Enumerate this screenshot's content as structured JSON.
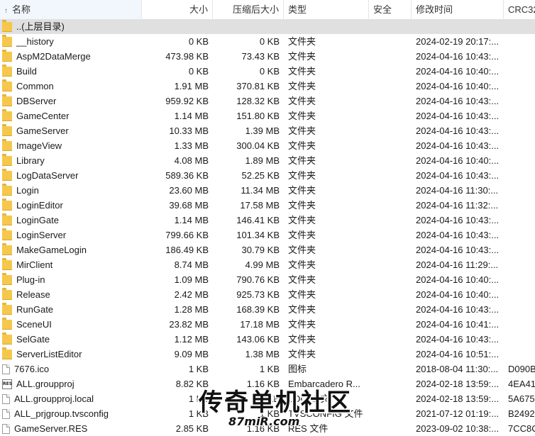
{
  "columns": {
    "name": "名称",
    "size": "大小",
    "compressed": "压缩后大小",
    "type": "类型",
    "security": "安全",
    "modified": "修改时间",
    "crc": "CRC32"
  },
  "rows": [
    {
      "icon": "folder-icon",
      "name": "..(上层目录)",
      "size": "",
      "csize": "",
      "type": "",
      "date": "",
      "crc": ""
    },
    {
      "icon": "folder-icon",
      "name": "__history",
      "size": "0 KB",
      "csize": "0 KB",
      "type": "文件夹",
      "date": "2024-02-19 20:17:...",
      "crc": ""
    },
    {
      "icon": "folder-icon",
      "name": "AspM2DataMerge",
      "size": "473.98 KB",
      "csize": "73.43 KB",
      "type": "文件夹",
      "date": "2024-04-16 10:43:...",
      "crc": ""
    },
    {
      "icon": "folder-icon",
      "name": "Build",
      "size": "0 KB",
      "csize": "0 KB",
      "type": "文件夹",
      "date": "2024-04-16 10:40:...",
      "crc": ""
    },
    {
      "icon": "folder-icon",
      "name": "Common",
      "size": "1.91 MB",
      "csize": "370.81 KB",
      "type": "文件夹",
      "date": "2024-04-16 10:40:...",
      "crc": ""
    },
    {
      "icon": "folder-icon",
      "name": "DBServer",
      "size": "959.92 KB",
      "csize": "128.32 KB",
      "type": "文件夹",
      "date": "2024-04-16 10:43:...",
      "crc": ""
    },
    {
      "icon": "folder-icon",
      "name": "GameCenter",
      "size": "1.14 MB",
      "csize": "151.80 KB",
      "type": "文件夹",
      "date": "2024-04-16 10:43:...",
      "crc": ""
    },
    {
      "icon": "folder-icon",
      "name": "GameServer",
      "size": "10.33 MB",
      "csize": "1.39 MB",
      "type": "文件夹",
      "date": "2024-04-16 10:43:...",
      "crc": ""
    },
    {
      "icon": "folder-icon",
      "name": "ImageView",
      "size": "1.33 MB",
      "csize": "300.04 KB",
      "type": "文件夹",
      "date": "2024-04-16 10:43:...",
      "crc": ""
    },
    {
      "icon": "folder-icon",
      "name": "Library",
      "size": "4.08 MB",
      "csize": "1.89 MB",
      "type": "文件夹",
      "date": "2024-04-16 10:40:...",
      "crc": ""
    },
    {
      "icon": "folder-icon",
      "name": "LogDataServer",
      "size": "589.36 KB",
      "csize": "52.25 KB",
      "type": "文件夹",
      "date": "2024-04-16 10:43:...",
      "crc": ""
    },
    {
      "icon": "folder-icon",
      "name": "Login",
      "size": "23.60 MB",
      "csize": "11.34 MB",
      "type": "文件夹",
      "date": "2024-04-16 11:30:...",
      "crc": ""
    },
    {
      "icon": "folder-icon",
      "name": "LoginEditor",
      "size": "39.68 MB",
      "csize": "17.58 MB",
      "type": "文件夹",
      "date": "2024-04-16 11:32:...",
      "crc": ""
    },
    {
      "icon": "folder-icon",
      "name": "LoginGate",
      "size": "1.14 MB",
      "csize": "146.41 KB",
      "type": "文件夹",
      "date": "2024-04-16 10:43:...",
      "crc": ""
    },
    {
      "icon": "folder-icon",
      "name": "LoginServer",
      "size": "799.66 KB",
      "csize": "101.34 KB",
      "type": "文件夹",
      "date": "2024-04-16 10:43:...",
      "crc": ""
    },
    {
      "icon": "folder-icon",
      "name": "MakeGameLogin",
      "size": "186.49 KB",
      "csize": "30.79 KB",
      "type": "文件夹",
      "date": "2024-04-16 10:43:...",
      "crc": ""
    },
    {
      "icon": "folder-icon",
      "name": "MirClient",
      "size": "8.74 MB",
      "csize": "4.99 MB",
      "type": "文件夹",
      "date": "2024-04-16 11:29:...",
      "crc": ""
    },
    {
      "icon": "folder-icon",
      "name": "Plug-in",
      "size": "1.09 MB",
      "csize": "790.76 KB",
      "type": "文件夹",
      "date": "2024-04-16 10:40:...",
      "crc": ""
    },
    {
      "icon": "folder-icon",
      "name": "Release",
      "size": "2.42 MB",
      "csize": "925.73 KB",
      "type": "文件夹",
      "date": "2024-04-16 10:40:...",
      "crc": ""
    },
    {
      "icon": "folder-icon",
      "name": "RunGate",
      "size": "1.28 MB",
      "csize": "168.39 KB",
      "type": "文件夹",
      "date": "2024-04-16 10:43:...",
      "crc": ""
    },
    {
      "icon": "folder-icon",
      "name": "SceneUI",
      "size": "23.82 MB",
      "csize": "17.18 MB",
      "type": "文件夹",
      "date": "2024-04-16 10:41:...",
      "crc": ""
    },
    {
      "icon": "folder-icon",
      "name": "SelGate",
      "size": "1.12 MB",
      "csize": "143.06 KB",
      "type": "文件夹",
      "date": "2024-04-16 10:43:...",
      "crc": ""
    },
    {
      "icon": "folder-icon",
      "name": "ServerListEditor",
      "size": "9.09 MB",
      "csize": "1.38 MB",
      "type": "文件夹",
      "date": "2024-04-16 10:51:...",
      "crc": ""
    },
    {
      "icon": "file-icon",
      "name": "7676.ico",
      "size": "1 KB",
      "csize": "1 KB",
      "type": "图标",
      "date": "2018-08-04 11:30:...",
      "crc": "D090B"
    },
    {
      "icon": "res-icon",
      "name": "ALL.groupproj",
      "size": "8.82 KB",
      "csize": "1.16 KB",
      "type": "Embarcadero R...",
      "date": "2024-02-18 13:59:...",
      "crc": "4EA41"
    },
    {
      "icon": "file-icon",
      "name": "ALL.groupproj.local",
      "size": "1 KB",
      "csize": "1 KB",
      "type": "LOCAL 文件",
      "date": "2024-02-18 13:59:...",
      "crc": "5A675"
    },
    {
      "icon": "file-icon",
      "name": "ALL_prjgroup.tvsconfig",
      "size": "1 KB",
      "csize": "1 KB",
      "type": "TVSCONFIG 文件",
      "date": "2021-07-12 01:19:...",
      "crc": "B2492"
    },
    {
      "icon": "file-icon",
      "name": "GameServer.RES",
      "size": "2.85 KB",
      "csize": "1.16 KB",
      "type": "RES 文件",
      "date": "2023-09-02 10:38:...",
      "crc": "7CC8C"
    }
  ],
  "res_icon_text": "RES",
  "watermark": {
    "main": "传奇单机社区",
    "sub": "87miR.com"
  }
}
